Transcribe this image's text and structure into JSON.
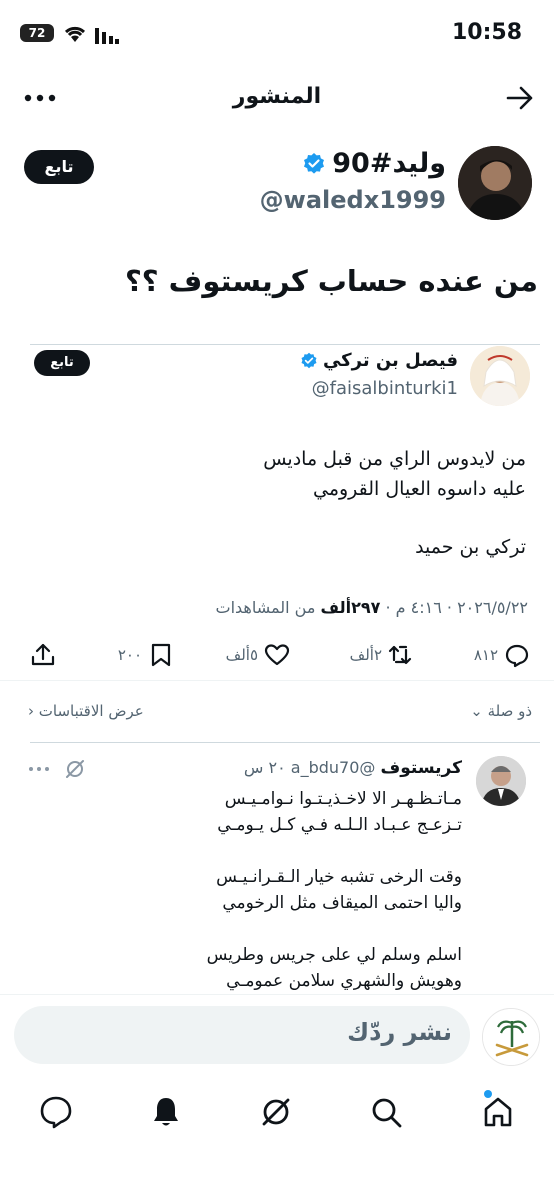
{
  "status": {
    "time": "10:58",
    "battery": "72"
  },
  "header": {
    "title": "المنشور"
  },
  "author": {
    "name": "وليد#90",
    "handle": "@waledx1999",
    "follow": "تابع"
  },
  "post": {
    "text": "من عنده حساب كريستوف ؟؟"
  },
  "embed": {
    "name": "فيصل بن تركي",
    "handle": "@faisalbinturki1",
    "follow": "تابع",
    "body_line1": "من لايدوس الراي من قبل ماديس",
    "body_line2": "عليه داسوه العيال القرومي",
    "signature": "تركي بن حميد",
    "date": "٢٠٢٦/٥/٢٢ · ٤:١٦ م ·",
    "views": "٢٩٧ألف",
    "views_label": "من المشاهدات",
    "replies": "٨١٢",
    "reposts": "٢ألف",
    "likes": "٥ألف",
    "bookmarks": "٢٠٠",
    "related": "ذو صلة",
    "quotes": "عرض الاقتباسات"
  },
  "reply": {
    "name": "كريستوف",
    "handle": "@a_bdu70",
    "time": "٢٠ س",
    "lines": [
      "مـاتـظـهـر الا لاخـذيـتـوا نـوامـيـس",
      "تـزعـج عـبـاد الـلـه فـي كـل يـومـي",
      "",
      "وقت الرخى تشبه خيار الـقـرانـيـس",
      "واليا احتمى الميقاف مثل الرخومي",
      "",
      "اسلم وسلم لي على جريس وطريس",
      "وهويش والشهري سلامن عمومـي"
    ]
  },
  "composer": {
    "placeholder": "نشر ردّك"
  },
  "colors": {
    "accent": "#1d9bf0",
    "text": "#0f1419",
    "muted": "#536471"
  }
}
